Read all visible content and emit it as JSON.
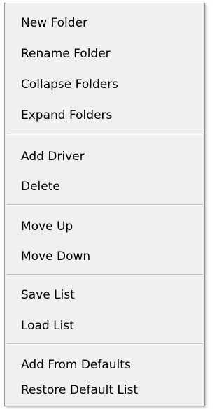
{
  "menu": {
    "items": [
      {
        "label": "New Folder"
      },
      {
        "label": "Rename Folder"
      },
      {
        "label": "Collapse Folders"
      },
      {
        "label": "Expand Folders"
      },
      {
        "label": "Add Driver"
      },
      {
        "label": "Delete"
      },
      {
        "label": "Move Up"
      },
      {
        "label": "Move Down"
      },
      {
        "label": "Save List"
      },
      {
        "label": "Load List"
      },
      {
        "label": "Add From Defaults"
      },
      {
        "label": "Restore Default List"
      }
    ]
  }
}
